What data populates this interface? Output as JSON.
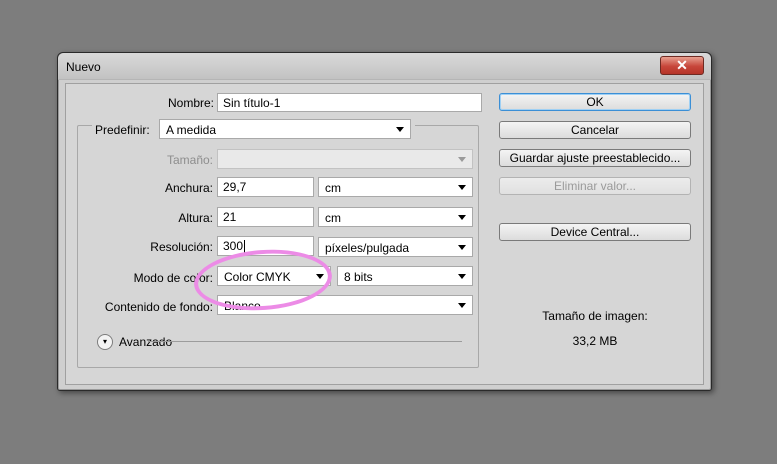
{
  "window": {
    "title": "Nuevo",
    "close_symbol": "✕"
  },
  "form": {
    "nombre": {
      "label": "Nombre:",
      "value": "Sin título-1"
    },
    "predefinir": {
      "label": "Predefinir:",
      "value": "A medida"
    },
    "tamano": {
      "label": "Tamaño:",
      "value": ""
    },
    "anchura": {
      "label": "Anchura:",
      "value": "29,7",
      "unit": "cm"
    },
    "altura": {
      "label": "Altura:",
      "value": "21",
      "unit": "cm"
    },
    "resolucion": {
      "label": "Resolución:",
      "value": "300",
      "unit": "píxeles/pulgada"
    },
    "modo_color": {
      "label": "Modo de color:",
      "value": "Color CMYK",
      "bits": "8 bits"
    },
    "contenido_fondo": {
      "label": "Contenido de fondo:",
      "value": "Blanco"
    },
    "avanzado": {
      "label": "Avanzado"
    }
  },
  "buttons": {
    "ok": "OK",
    "cancelar": "Cancelar",
    "guardar": "Guardar ajuste preestablecido...",
    "eliminar": "Eliminar valor...",
    "device_central": "Device Central..."
  },
  "image_info": {
    "label": "Tamaño de imagen:",
    "size": "33,2 MB"
  },
  "annotation": {
    "color": "#ec8be6"
  }
}
